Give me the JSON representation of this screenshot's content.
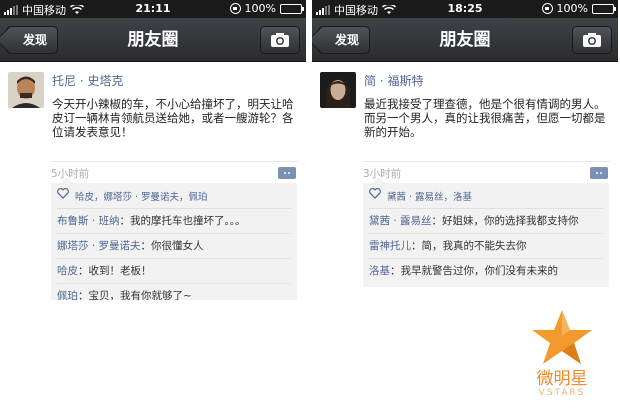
{
  "screens": [
    {
      "status": {
        "carrier": "中国移动",
        "time": "21:11",
        "battery": "100%"
      },
      "nav": {
        "back": "发现",
        "title": "朋友圈"
      },
      "post": {
        "author": "托尼 · 史塔克",
        "text": "今天开小辣椒的车，不小心给撞坏了，明天让哈皮订一辆林肯领航员送给她，或者一艘游轮？各位请发表意见！",
        "time": "5小时前",
        "likes": "哈皮，娜塔莎 · 罗曼诺夫，佩珀",
        "comments": [
          {
            "name": "布鲁斯 · 班纳",
            "text": "我的摩托车也撞坏了。。。"
          },
          {
            "name": "娜塔莎 · 罗曼诺夫",
            "text": "你很懂女人"
          },
          {
            "name": "哈皮",
            "text": "收到！老板！"
          },
          {
            "name": "佩珀",
            "text": "宝贝，我有你就够了~"
          }
        ]
      }
    },
    {
      "status": {
        "carrier": "中国移动",
        "time": "18:25",
        "battery": "100%"
      },
      "nav": {
        "back": "发现",
        "title": "朋友圈"
      },
      "post": {
        "author": "简 · 福斯特",
        "text": "最近我接受了理查德，他是个很有情调的男人。而另一个男人，真的让我很痛苦，但愿一切都是新的开始。",
        "time": "3小时前",
        "likes": "黛茜 · 露易丝，洛基",
        "comments": [
          {
            "name": "黛茜 · 露易丝",
            "text": "好姐妹，你的选择我都支持你"
          },
          {
            "name": "雷神托儿",
            "text": "简，我真的不能失去你"
          },
          {
            "name": "洛基",
            "text": "我早就警告过你，你们没有未来的"
          }
        ]
      }
    }
  ],
  "watermark": {
    "brand": "微明星",
    "sub": "VSTARS"
  },
  "colors": {
    "link": "#4f6794",
    "accent": "#f08a2a"
  },
  "icons": [
    "signal-icon",
    "wifi-icon",
    "rotation-lock-icon",
    "battery-icon",
    "camera-icon",
    "comment-icon",
    "heart-icon",
    "star-logo-icon"
  ]
}
